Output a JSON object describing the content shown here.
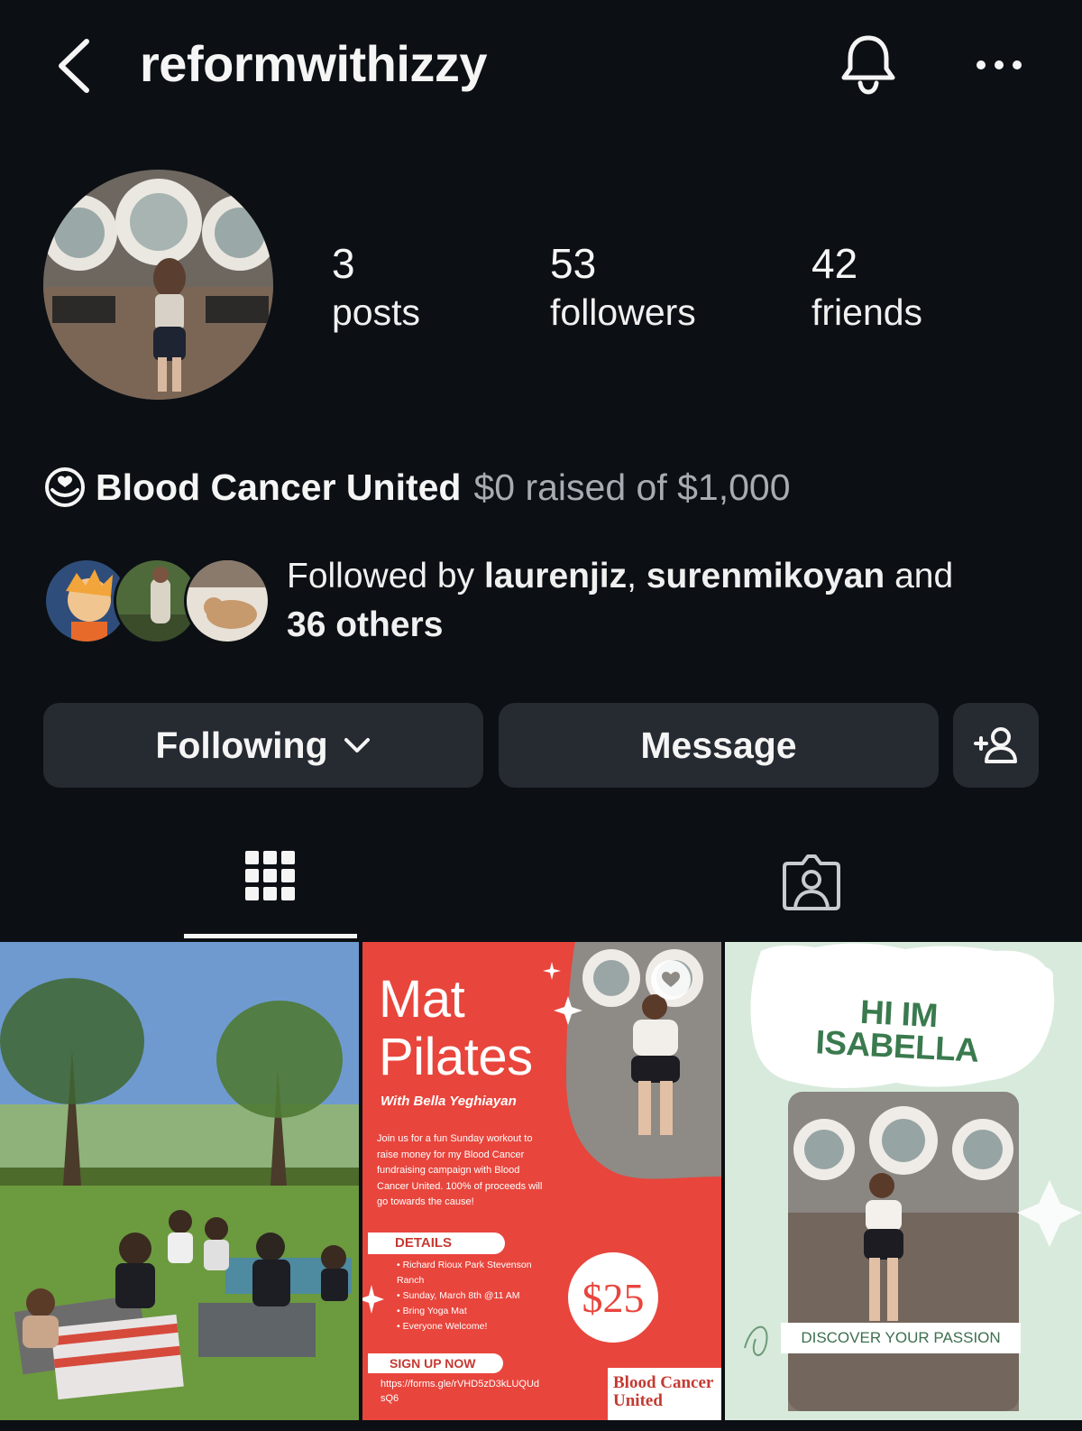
{
  "header": {
    "username": "reformwithizzy"
  },
  "stats": {
    "posts_count": "3",
    "posts_label": "posts",
    "followers_count": "53",
    "followers_label": "followers",
    "friends_count": "42",
    "friends_label": "friends"
  },
  "fundraiser": {
    "org": "Blood Cancer United",
    "amount": "$0 raised of $1,000"
  },
  "followed_by": {
    "prefix": "Followed by ",
    "user1": "laurenjiz",
    "sep": ", ",
    "user2": "surenmikoyan",
    "and": " and",
    "others": "36 others"
  },
  "actions": {
    "following_label": "Following",
    "message_label": "Message"
  },
  "posts": {
    "mat_pilates": {
      "title_line1": "Mat",
      "title_line2": "Pilates",
      "with": "With Bella Yeghiayan",
      "description": "Join us for a fun Sunday workout to raise money for my Blood Cancer fundraising campaign with Blood Cancer United. 100% of proceeds will go towards the cause!",
      "details_label": "DETAILS",
      "details": [
        "• Richard Rioux Park Stevenson Ranch",
        "• Sunday, March 8th @11 AM",
        "• Bring Yoga Mat",
        "• Everyone Welcome!"
      ],
      "signup_label": "SIGN UP NOW",
      "link": "https://forms.gle/rVHD5zD3kLUQUdsQ6",
      "price": "$25",
      "org": "Blood Cancer United"
    },
    "intro": {
      "title": "HI IM ISABELLA",
      "banner": "DISCOVER YOUR PASSION"
    }
  },
  "colors": {
    "background": "#0c1014",
    "button": "#262a31",
    "muted_text": "#a8acb2",
    "poster_red": "#e8453c",
    "poster_green": "#d8eadc"
  },
  "icons": {
    "back": "chevron-left-icon",
    "notifications": "bell-icon",
    "more": "more-dots-icon",
    "fundraiser": "fundraiser-heart-icon",
    "add_friend": "add-person-icon",
    "grid": "grid-icon",
    "tagged": "tagged-person-icon"
  }
}
